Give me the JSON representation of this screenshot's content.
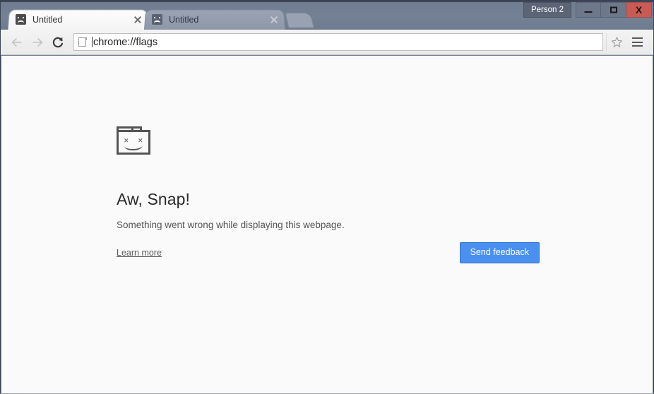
{
  "window": {
    "titlebar": {
      "person_button_label": "Person 2",
      "minimize_label": "",
      "maximize_label": "",
      "close_label": "X",
      "close_color": "#c95b53",
      "titlebar_color": "#737f93"
    },
    "tabs": [
      {
        "title": "Untitled",
        "favicon": "sad-page-favicon",
        "active": true,
        "close_label": ""
      },
      {
        "title": "Untitled",
        "favicon": "sad-page-favicon",
        "active": false,
        "close_label": ""
      }
    ],
    "new_tab_label": ""
  },
  "toolbar": {
    "back_label": "",
    "forward_label": "",
    "reload_label": "",
    "omnibox": {
      "value": "chrome://flags",
      "placeholder": "Search Google or type a URL",
      "page_icon": "document-icon"
    },
    "bookmark_label": "",
    "menu_label": ""
  },
  "content": {
    "icon": "sad-page-icon",
    "title": "Aw, Snap!",
    "description": "Something went wrong while displaying this webpage.",
    "learn_more_label": "Learn more",
    "send_feedback_label": "Send feedback",
    "accent_color": "#4a90f0",
    "background_color": "#fafafa"
  }
}
